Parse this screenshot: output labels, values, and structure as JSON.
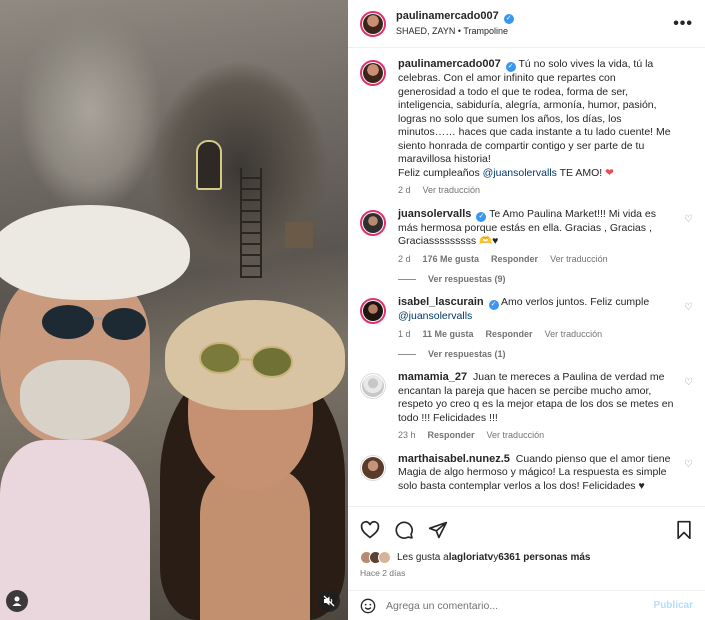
{
  "header": {
    "username": "paulinamercado007",
    "subtitle": "SHAED, ZAYN • Trampoline",
    "more": "•••"
  },
  "caption": {
    "username": "paulinamercado007",
    "text": "Tú no solo vives la vida, tú la celebras. Con el amor infinito que repartes con generosidad a todo el que te rodea, forma de ser, inteligencia, sabiduría, alegría, armonía, humor, pasión, logras no solo que sumen los años, los días, los minutos…… haces que cada instante a tu lado cuente! Me siento honrada de compartir contigo y ser parte de tu maravillosa historia!",
    "line2_pre": "Feliz cumpleaños ",
    "mention": "@juansolervalls",
    "line2_post": " TE AMO! ",
    "heart": "❤",
    "time": "2 d",
    "translate": "Ver traducción"
  },
  "comments": [
    {
      "username": "juansolervalls",
      "verified": true,
      "text": "Te Amo Paulina Market!!! Mi vida es más hermosa porque estás en ella. Gracias , Gracias , Graciasssssssss 🫶♥",
      "time": "2 d",
      "likes": "176 Me gusta",
      "reply": "Responder",
      "translate": "Ver traducción",
      "view_replies": "Ver respuestas (9)"
    },
    {
      "username": "isabel_lascurain",
      "verified": true,
      "text_pre": "Amo verlos juntos. Feliz cumple ",
      "mention": "@juansolervalls",
      "time": "1 d",
      "likes": "11 Me gusta",
      "reply": "Responder",
      "translate": "Ver traducción",
      "view_replies": "Ver respuestas (1)"
    },
    {
      "username": "mamamia_27",
      "text": "Juan te mereces a Paulina de verdad me encantan la pareja que hacen se percibe mucho amor, respeto yo creo q es la mejor etapa de los dos se metes en todo !!! Felicidades !!!",
      "time": "23 h",
      "reply": "Responder",
      "translate": "Ver traducción"
    },
    {
      "username": "marthaisabel.nunez.5",
      "text": "Cuando pienso que el amor tiene Magia de algo hermoso y mágico! La respuesta es simple solo basta contemplar verlos a los dos! Felicidades ♥"
    }
  ],
  "likes": {
    "pre": "Les gusta a ",
    "user": "lagloriatv",
    "mid": " y ",
    "count": "6361 personas más"
  },
  "date": "Hace 2 días",
  "add_comment": {
    "placeholder": "Agrega un comentario...",
    "post": "Publicar"
  },
  "colors": {
    "accent": "#3897f0",
    "heart": "#ed4956",
    "post_disabled": "#b2dffc"
  }
}
